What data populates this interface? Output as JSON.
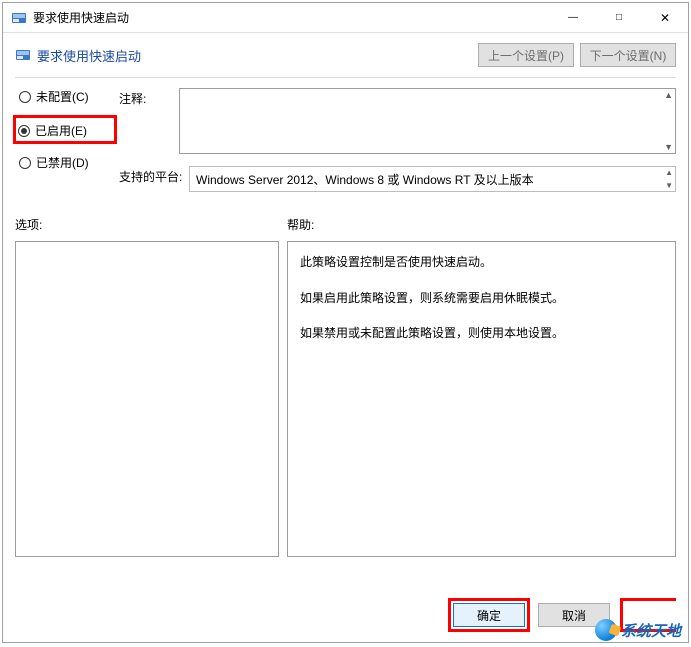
{
  "titlebar": {
    "title": "要求使用快速启动"
  },
  "header": {
    "title": "要求使用快速启动",
    "prev": "上一个设置(P)",
    "next": "下一个设置(N)"
  },
  "radios": {
    "not_configured": "未配置(C)",
    "enabled": "已启用(E)",
    "disabled": "已禁用(D)"
  },
  "fields": {
    "comment_label": "注释:",
    "platform_label": "支持的平台:",
    "platform_value": "Windows Server 2012、Windows 8 或 Windows RT 及以上版本"
  },
  "labels": {
    "options": "选项:",
    "help": "帮助:"
  },
  "help": {
    "p1": "此策略设置控制是否使用快速启动。",
    "p2": "如果启用此策略设置，则系统需要启用休眠模式。",
    "p3": "如果禁用或未配置此策略设置，则使用本地设置。"
  },
  "footer": {
    "ok": "确定",
    "cancel": "取消"
  },
  "watermark": {
    "text": "系统天地"
  }
}
